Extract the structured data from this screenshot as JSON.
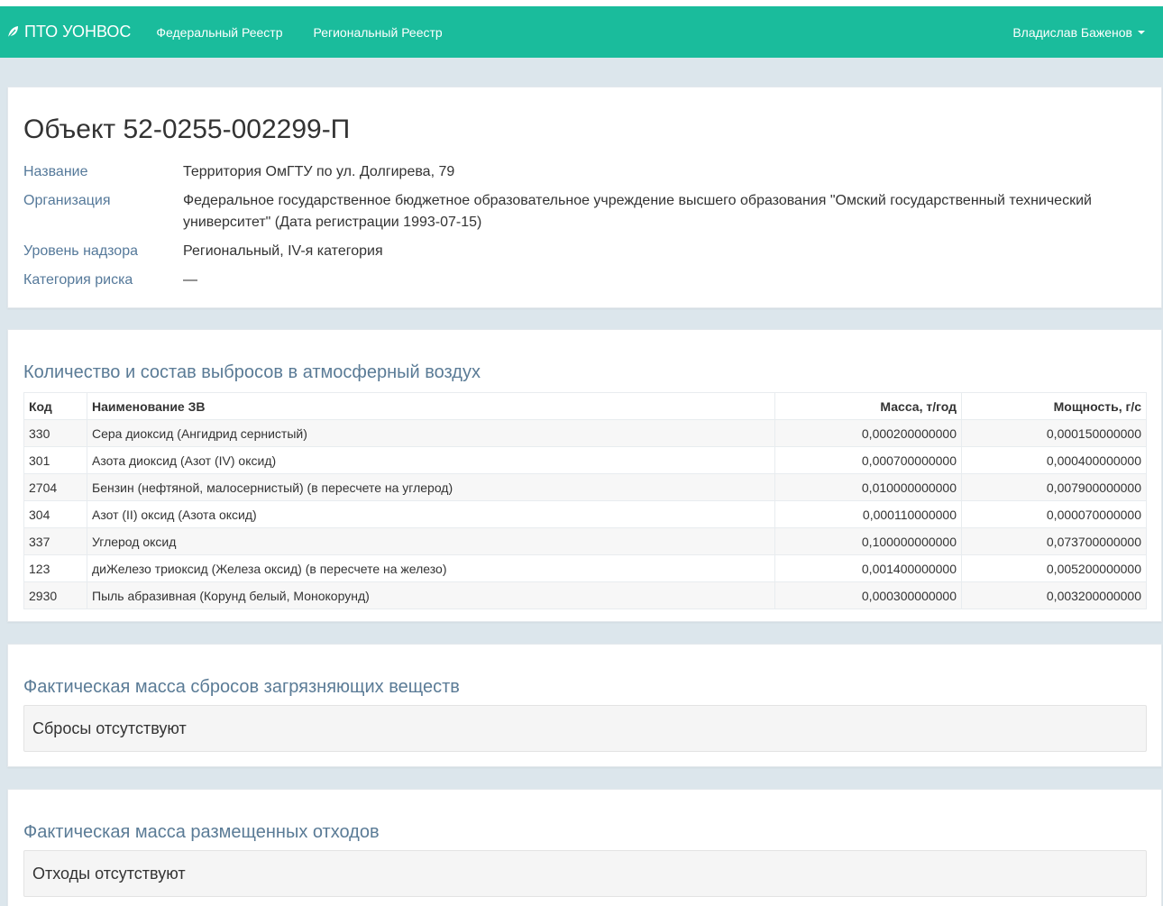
{
  "navbar": {
    "brand": "ПТО УОНВОС",
    "links": [
      "Федеральный Реестр",
      "Региональный Реестр"
    ],
    "user": "Владислав Баженов"
  },
  "object": {
    "title": "Объект 52-0255-002299-П",
    "fields": [
      {
        "label": "Название",
        "value": "Территория ОмГТУ по ул. Долгирева, 79"
      },
      {
        "label": "Организация",
        "value": "Федеральное государственное бюджетное образовательное учреждение высшего образования \"Омский государственный технический университет\" (Дата регистрации 1993-07-15)"
      },
      {
        "label": "Уровень надзора",
        "value": "Региональный, IV-я категория"
      },
      {
        "label": "Категория риска",
        "value": "—"
      }
    ]
  },
  "emissions": {
    "title": "Количество и состав выбросов в атмосферный воздух",
    "columns": [
      "Код",
      "Наименование ЗВ",
      "Масса, т/год",
      "Мощность, г/с"
    ],
    "rows": [
      [
        "330",
        "Сера диоксид (Ангидрид сернистый)",
        "0,000200000000",
        "0,000150000000"
      ],
      [
        "301",
        "Азота диоксид (Азот (IV) оксид)",
        "0,000700000000",
        "0,000400000000"
      ],
      [
        "2704",
        "Бензин (нефтяной, малосернистый) (в пересчете на углерод)",
        "0,010000000000",
        "0,007900000000"
      ],
      [
        "304",
        "Азот (II) оксид (Азота оксид)",
        "0,000110000000",
        "0,000070000000"
      ],
      [
        "337",
        "Углерод оксид",
        "0,100000000000",
        "0,073700000000"
      ],
      [
        "123",
        "диЖелезо триоксид (Железа оксид) (в пересчете на железо)",
        "0,001400000000",
        "0,005200000000"
      ],
      [
        "2930",
        "Пыль абразивная (Корунд белый, Монокорунд)",
        "0,000300000000",
        "0,003200000000"
      ]
    ]
  },
  "discharges": {
    "title": "Фактическая масса сбросов загрязняющих веществ",
    "empty_text": "Сбросы отсутствуют"
  },
  "waste": {
    "title": "Фактическая масса размещенных отходов",
    "empty_text": "Отходы отсутствуют"
  }
}
